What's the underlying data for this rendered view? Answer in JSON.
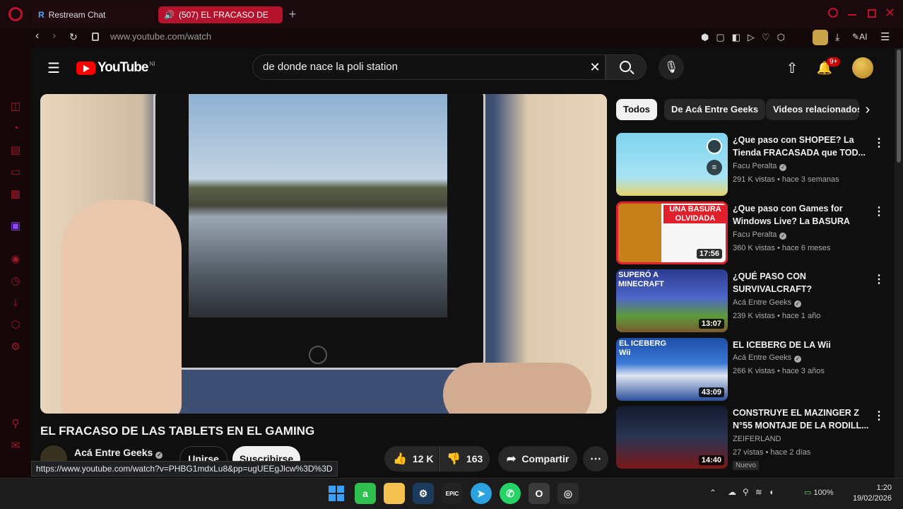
{
  "browser": {
    "tabs": [
      {
        "title": "Restream Chat",
        "active": false
      },
      {
        "title": "(507) EL FRACASO DE",
        "active": true
      }
    ],
    "url": "www.youtube.com/watch",
    "ai_label": "AI"
  },
  "youtube": {
    "logo_text": "YouTube",
    "logo_country": "NI",
    "search_query": "de donde nace la poli station",
    "notification_count": "9+",
    "video": {
      "title": "EL FRACASO DE LAS TABLETS EN EL GAMING",
      "channel": "Acá Entre Geeks",
      "join_label": "Unirse",
      "subscribe_label": "Suscribirse",
      "likes": "12 K",
      "dislikes": "163",
      "share_label": "Compartir"
    },
    "chips": [
      "Todos",
      "De Acá Entre Geeks",
      "Videos relacionados"
    ],
    "recommendations": [
      {
        "title": "¿Que paso con SHOPEE? La Tienda FRACASADA que TOD...",
        "channel": "Facu Peralta",
        "meta": "291 K vistas • hace 3 semanas",
        "duration": "",
        "thumb_text": ""
      },
      {
        "title": "¿Que paso con Games for Windows Live? La BASURA del...",
        "channel": "Facu Peralta",
        "meta": "360 K vistas • hace 6 meses",
        "duration": "17:56",
        "thumb_text": "UNA BASURA OLVIDADA"
      },
      {
        "title": "¿QUÉ PASO CON SURVIVALCRAFT?",
        "channel": "Acá Entre Geeks",
        "meta": "239 K vistas • hace 1 año",
        "duration": "13:07",
        "thumb_text": "SUPERÓ A MINECRAFT"
      },
      {
        "title": "EL ICEBERG DE LA Wii",
        "channel": "Acá Entre Geeks",
        "meta": "266 K vistas • hace 3 años",
        "duration": "43:09",
        "thumb_text": "EL ICEBERG Wii"
      },
      {
        "title": "CONSTRUYE EL MAZINGER Z N°55 MONTAJE DE LA RODILL...",
        "channel": "ZEIFERLAND",
        "meta": "27 vistas • hace 2 días",
        "duration": "14:40",
        "thumb_text": "",
        "badge": "Nuevo"
      }
    ]
  },
  "status_url": "https://www.youtube.com/watch?v=PHBG1mdxLu8&pp=ugUEEgJlcw%3D%3D",
  "taskbar": {
    "battery": "100%",
    "time": "1:20",
    "date": "19/02/2026"
  },
  "colors": {
    "accent": "#c3102f",
    "yt_red": "#ff0000",
    "bg": "#0f0f0f"
  }
}
